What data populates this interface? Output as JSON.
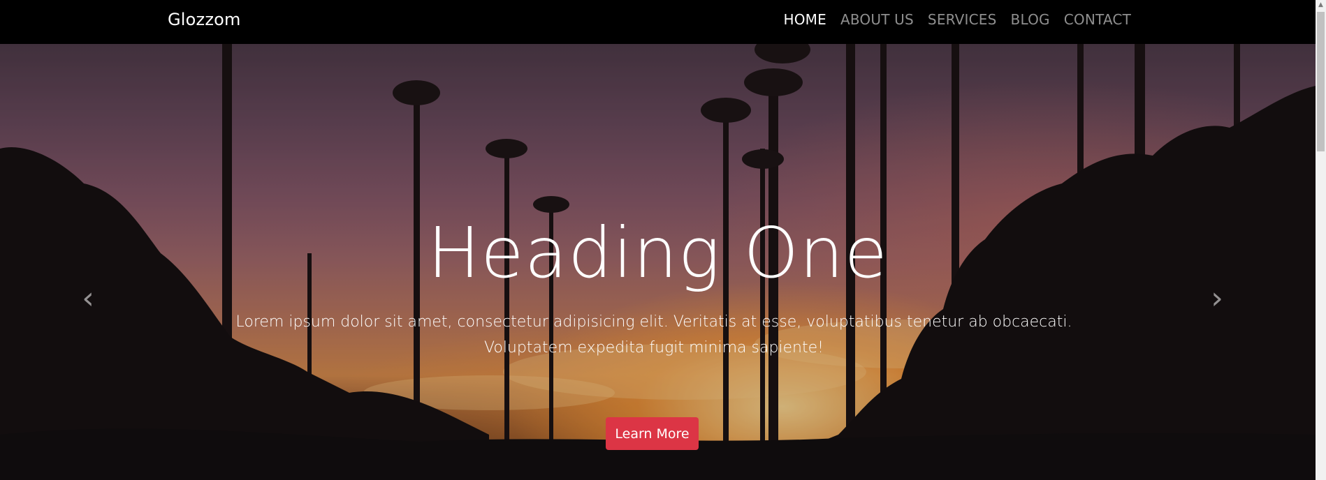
{
  "navbar": {
    "brand": "Glozzom",
    "links": [
      {
        "label": "HOME",
        "active": true
      },
      {
        "label": "ABOUT US",
        "active": false
      },
      {
        "label": "SERVICES",
        "active": false
      },
      {
        "label": "BLOG",
        "active": false
      },
      {
        "label": "CONTACT",
        "active": false
      }
    ]
  },
  "hero": {
    "title": "Heading One",
    "text": "Lorem ipsum dolor sit amet, consectetur adipisicing elit. Veritatis at esse, voluptatibus tenetur ab obcaecati. Voluptatem expedita fugit minima sapiente!",
    "button_label": "Learn More",
    "button_color": "#dc3545",
    "prev_icon": "chevron-left-icon",
    "next_icon": "chevron-right-icon",
    "indicators": [
      true,
      false,
      false
    ]
  }
}
